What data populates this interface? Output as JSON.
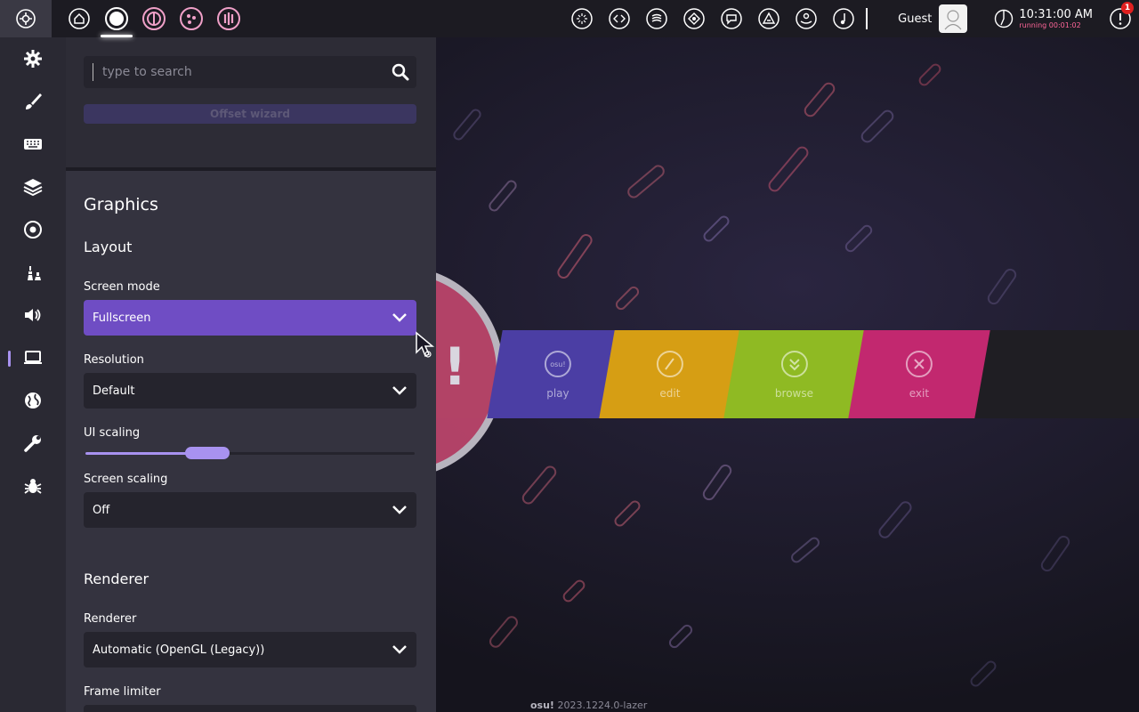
{
  "toolbar": {
    "ruleset_icons": [
      "osu-ruleset-icon",
      "taiko-ruleset-icon",
      "catch-ruleset-icon",
      "mania-ruleset-icon"
    ],
    "active_ruleset": "osu-ruleset-icon",
    "right_icons": [
      "chat-icon",
      "dashboard-icon",
      "news-icon",
      "rankings-icon",
      "beatmap-listing-icon",
      "changelog-icon",
      "wiki-icon",
      "music-icon"
    ],
    "user_name": "Guest",
    "clock_time": "10:31:00 AM",
    "clock_running": "running 00:01:02",
    "notification_count": "1"
  },
  "sidebar": {
    "items": [
      "gear-icon",
      "brush-icon",
      "keyboard-icon",
      "layers-icon",
      "target-icon",
      "chess-icon",
      "speaker-icon",
      "laptop-icon",
      "globe-icon",
      "wrench-icon",
      "bug-icon"
    ],
    "active": "laptop-icon"
  },
  "settings": {
    "search_placeholder": "type to search",
    "offset_wizard_label": "Offset wizard",
    "section_title": "Graphics",
    "layout_title": "Layout",
    "screen_mode_label": "Screen mode",
    "screen_mode_value": "Fullscreen",
    "resolution_label": "Resolution",
    "resolution_value": "Default",
    "ui_scaling_label": "UI scaling",
    "ui_scaling_level": 0.35,
    "screen_scaling_label": "Screen scaling",
    "screen_scaling_value": "Off",
    "renderer_title": "Renderer",
    "renderer_label": "Renderer",
    "renderer_value": "Automatic (OpenGL (Legacy))",
    "frame_limiter_label": "Frame limiter"
  },
  "main_menu": {
    "buttons": [
      {
        "label": "play",
        "color": "#4b3ea4",
        "icon": "osu!"
      },
      {
        "label": "edit",
        "color": "#d69e14"
      },
      {
        "label": "browse",
        "color": "#8fba23"
      },
      {
        "label": "exit",
        "color": "#c2286f"
      }
    ],
    "version_app": "osu!",
    "version_number": "2023.1224.0-lazer"
  },
  "colors": {
    "accent": "#a892f0",
    "dropdown_selected": "#6f4dc4",
    "panel_bg": "#34333f",
    "sidebar_bg": "#2a2933"
  }
}
